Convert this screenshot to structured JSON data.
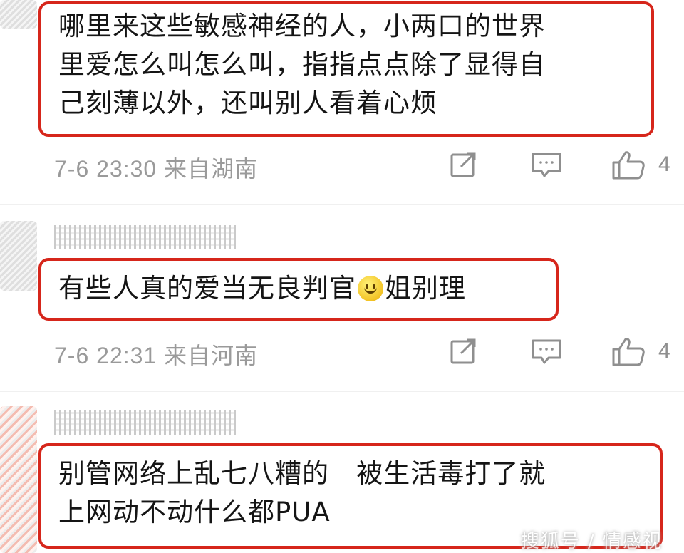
{
  "comments": [
    {
      "text": "哪里来这些敏感神经的人，小两口的世界\n里爱怎么叫怎么叫，指指点点除了显得自\n己刻薄以外，还叫别人看着心烦",
      "meta": "7-6 23:30  来自湖南",
      "likes": "4"
    },
    {
      "text_before": "有些人真的爱当无良判官",
      "text_after": "姐别理",
      "emoji": "smile-emoji",
      "meta": "7-6 22:31  来自河南",
      "likes": "4"
    },
    {
      "text": "别管网络上乱七八糟的   被生活毒打了就\n上网动不动什么都PUA"
    }
  ],
  "watermark": "搜狐号 / 情感视",
  "colors": {
    "highlight_border": "#d6261b",
    "meta_text": "#9a9a9a",
    "icon": "#8f8f8f"
  },
  "icons": [
    "share-icon",
    "comment-icon",
    "like-icon"
  ]
}
